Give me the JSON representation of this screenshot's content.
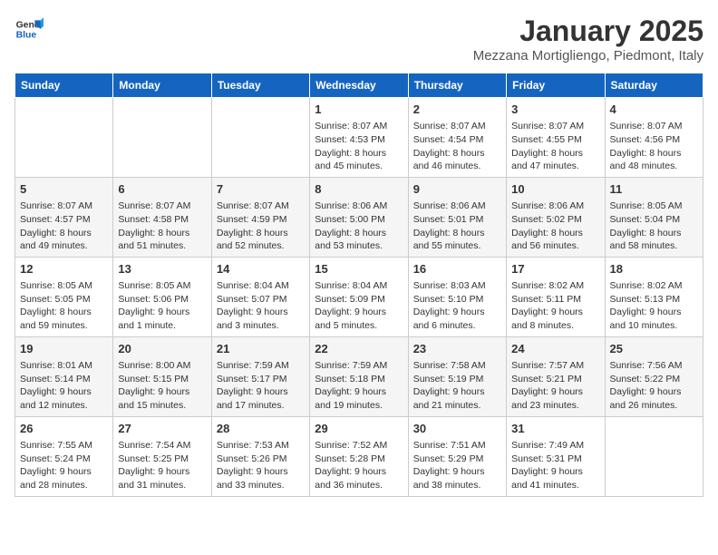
{
  "header": {
    "logo_line1": "General",
    "logo_line2": "Blue",
    "title": "January 2025",
    "subtitle": "Mezzana Mortigliengo, Piedmont, Italy"
  },
  "days_of_week": [
    "Sunday",
    "Monday",
    "Tuesday",
    "Wednesday",
    "Thursday",
    "Friday",
    "Saturday"
  ],
  "weeks": [
    [
      {
        "day": "",
        "content": ""
      },
      {
        "day": "",
        "content": ""
      },
      {
        "day": "",
        "content": ""
      },
      {
        "day": "1",
        "content": "Sunrise: 8:07 AM\nSunset: 4:53 PM\nDaylight: 8 hours and 45 minutes."
      },
      {
        "day": "2",
        "content": "Sunrise: 8:07 AM\nSunset: 4:54 PM\nDaylight: 8 hours and 46 minutes."
      },
      {
        "day": "3",
        "content": "Sunrise: 8:07 AM\nSunset: 4:55 PM\nDaylight: 8 hours and 47 minutes."
      },
      {
        "day": "4",
        "content": "Sunrise: 8:07 AM\nSunset: 4:56 PM\nDaylight: 8 hours and 48 minutes."
      }
    ],
    [
      {
        "day": "5",
        "content": "Sunrise: 8:07 AM\nSunset: 4:57 PM\nDaylight: 8 hours and 49 minutes."
      },
      {
        "day": "6",
        "content": "Sunrise: 8:07 AM\nSunset: 4:58 PM\nDaylight: 8 hours and 51 minutes."
      },
      {
        "day": "7",
        "content": "Sunrise: 8:07 AM\nSunset: 4:59 PM\nDaylight: 8 hours and 52 minutes."
      },
      {
        "day": "8",
        "content": "Sunrise: 8:06 AM\nSunset: 5:00 PM\nDaylight: 8 hours and 53 minutes."
      },
      {
        "day": "9",
        "content": "Sunrise: 8:06 AM\nSunset: 5:01 PM\nDaylight: 8 hours and 55 minutes."
      },
      {
        "day": "10",
        "content": "Sunrise: 8:06 AM\nSunset: 5:02 PM\nDaylight: 8 hours and 56 minutes."
      },
      {
        "day": "11",
        "content": "Sunrise: 8:05 AM\nSunset: 5:04 PM\nDaylight: 8 hours and 58 minutes."
      }
    ],
    [
      {
        "day": "12",
        "content": "Sunrise: 8:05 AM\nSunset: 5:05 PM\nDaylight: 8 hours and 59 minutes."
      },
      {
        "day": "13",
        "content": "Sunrise: 8:05 AM\nSunset: 5:06 PM\nDaylight: 9 hours and 1 minute."
      },
      {
        "day": "14",
        "content": "Sunrise: 8:04 AM\nSunset: 5:07 PM\nDaylight: 9 hours and 3 minutes."
      },
      {
        "day": "15",
        "content": "Sunrise: 8:04 AM\nSunset: 5:09 PM\nDaylight: 9 hours and 5 minutes."
      },
      {
        "day": "16",
        "content": "Sunrise: 8:03 AM\nSunset: 5:10 PM\nDaylight: 9 hours and 6 minutes."
      },
      {
        "day": "17",
        "content": "Sunrise: 8:02 AM\nSunset: 5:11 PM\nDaylight: 9 hours and 8 minutes."
      },
      {
        "day": "18",
        "content": "Sunrise: 8:02 AM\nSunset: 5:13 PM\nDaylight: 9 hours and 10 minutes."
      }
    ],
    [
      {
        "day": "19",
        "content": "Sunrise: 8:01 AM\nSunset: 5:14 PM\nDaylight: 9 hours and 12 minutes."
      },
      {
        "day": "20",
        "content": "Sunrise: 8:00 AM\nSunset: 5:15 PM\nDaylight: 9 hours and 15 minutes."
      },
      {
        "day": "21",
        "content": "Sunrise: 7:59 AM\nSunset: 5:17 PM\nDaylight: 9 hours and 17 minutes."
      },
      {
        "day": "22",
        "content": "Sunrise: 7:59 AM\nSunset: 5:18 PM\nDaylight: 9 hours and 19 minutes."
      },
      {
        "day": "23",
        "content": "Sunrise: 7:58 AM\nSunset: 5:19 PM\nDaylight: 9 hours and 21 minutes."
      },
      {
        "day": "24",
        "content": "Sunrise: 7:57 AM\nSunset: 5:21 PM\nDaylight: 9 hours and 23 minutes."
      },
      {
        "day": "25",
        "content": "Sunrise: 7:56 AM\nSunset: 5:22 PM\nDaylight: 9 hours and 26 minutes."
      }
    ],
    [
      {
        "day": "26",
        "content": "Sunrise: 7:55 AM\nSunset: 5:24 PM\nDaylight: 9 hours and 28 minutes."
      },
      {
        "day": "27",
        "content": "Sunrise: 7:54 AM\nSunset: 5:25 PM\nDaylight: 9 hours and 31 minutes."
      },
      {
        "day": "28",
        "content": "Sunrise: 7:53 AM\nSunset: 5:26 PM\nDaylight: 9 hours and 33 minutes."
      },
      {
        "day": "29",
        "content": "Sunrise: 7:52 AM\nSunset: 5:28 PM\nDaylight: 9 hours and 36 minutes."
      },
      {
        "day": "30",
        "content": "Sunrise: 7:51 AM\nSunset: 5:29 PM\nDaylight: 9 hours and 38 minutes."
      },
      {
        "day": "31",
        "content": "Sunrise: 7:49 AM\nSunset: 5:31 PM\nDaylight: 9 hours and 41 minutes."
      },
      {
        "day": "",
        "content": ""
      }
    ]
  ]
}
